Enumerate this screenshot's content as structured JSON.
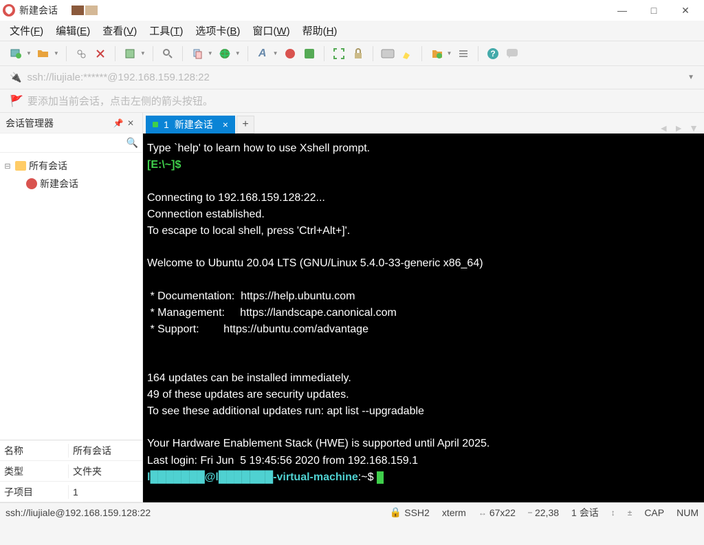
{
  "title": "新建会话",
  "window_controls": {
    "min": "—",
    "max": "□",
    "close": "✕"
  },
  "menus": [
    {
      "text": "文件",
      "k": "F"
    },
    {
      "text": "编辑",
      "k": "E"
    },
    {
      "text": "查看",
      "k": "V"
    },
    {
      "text": "工具",
      "k": "T"
    },
    {
      "text": "选项卡",
      "k": "B"
    },
    {
      "text": "窗口",
      "k": "W"
    },
    {
      "text": "帮助",
      "k": "H"
    }
  ],
  "address": "ssh://liujiale:******@192.168.159.128:22",
  "hint": "要添加当前会话，点击左侧的箭头按钮。",
  "sidebar": {
    "title": "会话管理器",
    "root": "所有会话",
    "child": "新建会话",
    "props": [
      {
        "k": "名称",
        "v": "所有会话"
      },
      {
        "k": "类型",
        "v": "文件夹"
      },
      {
        "k": "子项目",
        "v": "1"
      }
    ]
  },
  "tab": {
    "num": "1",
    "label": "新建会话"
  },
  "terminal": {
    "l1": "Type `help' to learn how to use Xshell prompt.",
    "prompt": "[E:\\~]$",
    "l2": "Connecting to 192.168.159.128:22...",
    "l3": "Connection established.",
    "l4": "To escape to local shell, press 'Ctrl+Alt+]'.",
    "l5": "Welcome to Ubuntu 20.04 LTS (GNU/Linux 5.4.0-33-generic x86_64)",
    "l6": " * Documentation:  https://help.ubuntu.com",
    "l7": " * Management:     https://landscape.canonical.com",
    "l8": " * Support:        https://ubuntu.com/advantage",
    "l9": "164 updates can be installed immediately.",
    "l10": "49 of these updates are security updates.",
    "l11": "To see these additional updates run: apt list --upgradable",
    "l12": "Your Hardware Enablement Stack (HWE) is supported until April 2025.",
    "l13": "Last login: Fri Jun  5 19:45:56 2020 from 192.168.159.1",
    "shell_prompt_user": "l███████@l███████-virtual-machine",
    "shell_prompt_path": ":~$ "
  },
  "status": {
    "conn": "ssh://liujiale@192.168.159.128:22",
    "proto": "SSH2",
    "term": "xterm",
    "size": "67x22",
    "pos": "22,38",
    "sess": "1 会话",
    "caps": "CAP",
    "num": "NUM"
  }
}
